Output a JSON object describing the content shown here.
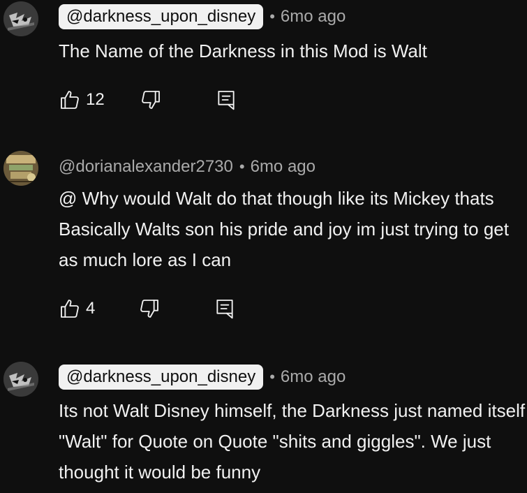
{
  "comments": [
    {
      "handle": "@darkness_upon_disney",
      "handle_highlighted": true,
      "time": "6mo ago",
      "text": "The Name of the Darkness in this Mod is Walt",
      "likes": "12"
    },
    {
      "handle": "@dorianalexander2730",
      "handle_highlighted": false,
      "time": "6mo ago",
      "text": "@  Why would Walt do that though like its Mickey thats Basically Walts son his pride and joy im just trying to get as much lore as I can",
      "likes": "4"
    },
    {
      "handle": "@darkness_upon_disney",
      "handle_highlighted": true,
      "time": "6mo ago",
      "text": "Its not Walt Disney himself, the Darkness just named itself \"Walt\" for Quote on Quote \"shits and giggles\". We just thought it would be funny"
    }
  ],
  "separator": "•",
  "icons": {
    "like": "thumbs-up-icon",
    "dislike": "thumbs-down-icon",
    "reply": "reply-icon"
  },
  "colors": {
    "background": "#0f0f0f",
    "text": "#f1f1f1",
    "secondary_text": "#aaaaaa",
    "pill_background": "#f1f1f1",
    "pill_text": "#0f0f0f"
  }
}
